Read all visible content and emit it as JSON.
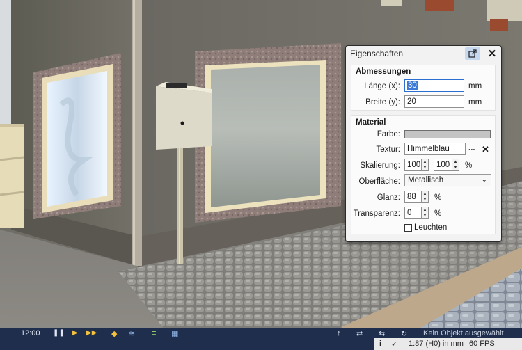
{
  "panel": {
    "title": "Eigenschaften",
    "popout_icon": "popout-icon",
    "close_glyph": "✕",
    "dimensions": {
      "heading": "Abmessungen",
      "length_label": "Länge (x):",
      "length_value": "30",
      "length_unit": "mm",
      "width_label": "Breite (y):",
      "width_value": "20",
      "width_unit": "mm"
    },
    "material": {
      "heading": "Material",
      "color_label": "Farbe:",
      "color_value": "#c4c4c4",
      "texture_label": "Textur:",
      "texture_value": "Himmelblau",
      "browse_label": "...",
      "clear_glyph": "✕",
      "scale_label": "Skalierung:",
      "scale_x": "100",
      "scale_y": "100",
      "scale_unit": "%",
      "surface_label": "Oberfläche:",
      "surface_value": "Metallisch",
      "gloss_label": "Glanz:",
      "gloss_value": "88",
      "gloss_unit": "%",
      "transparency_label": "Transparenz:",
      "transparency_value": "0",
      "transparency_unit": "%",
      "glow_label": "Leuchten"
    }
  },
  "toolbar": {
    "time": "12:00",
    "selection_text": "Kein Objekt ausgewählt"
  },
  "status": {
    "info_glyph": "i",
    "check_glyph": "✓",
    "scale_text": "1:87 (H0) in mm",
    "fps_text": "60 FPS"
  }
}
